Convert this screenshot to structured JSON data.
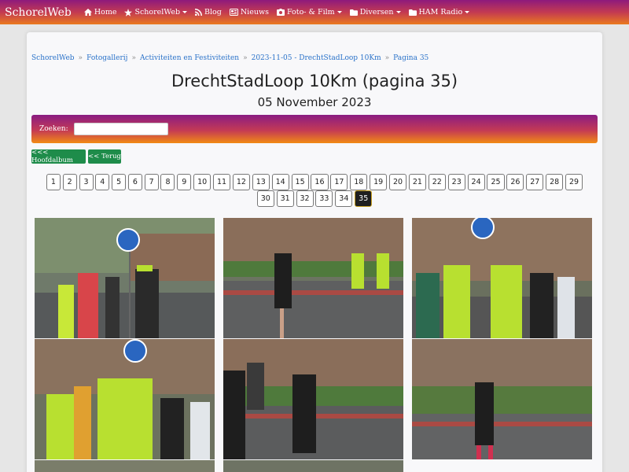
{
  "navbar": {
    "brand": "SchorelWeb",
    "items": [
      {
        "label": "Home",
        "icon": "home-icon",
        "dropdown": false
      },
      {
        "label": "SchorelWeb",
        "icon": "star-icon",
        "dropdown": true
      },
      {
        "label": "Blog",
        "icon": "rss-icon",
        "dropdown": false
      },
      {
        "label": "Nieuws",
        "icon": "newspaper-icon",
        "dropdown": false
      },
      {
        "label": "Foto- & Film",
        "icon": "camera-icon",
        "dropdown": true
      },
      {
        "label": "Diversen",
        "icon": "folder-icon",
        "dropdown": true
      },
      {
        "label": "HAM Radio",
        "icon": "folder-icon",
        "dropdown": true
      }
    ]
  },
  "breadcrumb": {
    "items": [
      "SchorelWeb",
      "Fotogallerij",
      "Activiteiten en Festiviteiten",
      "2023-11-05 - DrechtStadLoop 10Km",
      "Pagina 35"
    ],
    "separator": "»"
  },
  "page": {
    "title": "DrechtStadLoop 10Km (pagina 35)",
    "date": "05 November 2023"
  },
  "search": {
    "label": "Zoeken:",
    "value": ""
  },
  "buttons": {
    "main_album": "<<< Hoofdalbum",
    "back": "<< Terug"
  },
  "pagination": {
    "row1": [
      "1",
      "2",
      "3",
      "4",
      "5",
      "6",
      "7",
      "8",
      "9",
      "10",
      "11",
      "12",
      "13",
      "14",
      "15",
      "16",
      "17",
      "18",
      "19",
      "20",
      "21",
      "22",
      "23",
      "24",
      "25",
      "26",
      "27",
      "28",
      "29"
    ],
    "row2": [
      "30",
      "31",
      "32",
      "33",
      "34",
      "35"
    ],
    "current": "35"
  },
  "colors": {
    "accent_green": "#1e8c4a",
    "nav_start": "#8e1a7c",
    "nav_end": "#ea7a1e",
    "link": "#2a72c9"
  }
}
